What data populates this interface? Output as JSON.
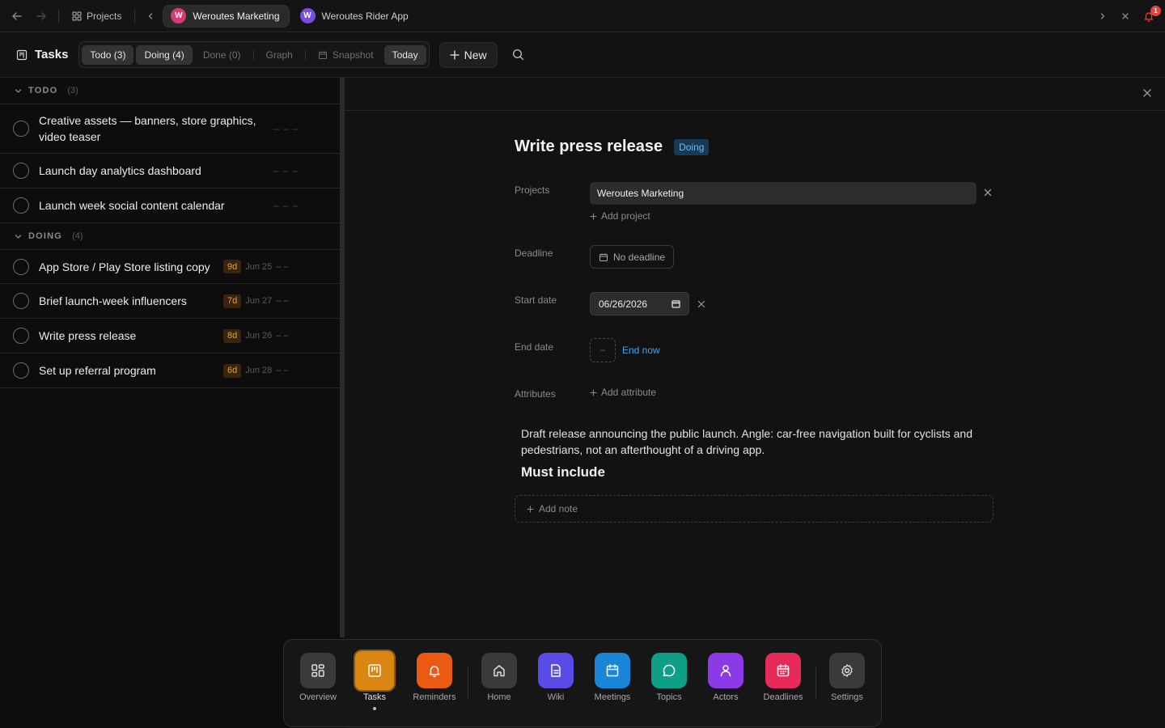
{
  "topbar": {
    "projects_label": "Projects",
    "tabs": [
      {
        "label": "Weroutes Marketing",
        "initial": "W",
        "color": "#d63a78",
        "active": true
      },
      {
        "label": "Weroutes Rider App",
        "initial": "W",
        "color": "#7a4ce0",
        "active": false
      }
    ],
    "notification_count": "1"
  },
  "toolbar": {
    "title": "Tasks",
    "filters": {
      "todo": "Todo (3)",
      "doing": "Doing (4)",
      "done": "Done (0)",
      "graph": "Graph",
      "snapshot": "Snapshot",
      "today": "Today"
    },
    "new_label": "New"
  },
  "list": {
    "todo": {
      "label": "TODO",
      "count": "(3)",
      "items": [
        {
          "title": "Creative assets — banners, store graphics, video teaser",
          "dashes": "– – –"
        },
        {
          "title": "Launch day analytics dashboard",
          "dashes": "– – –"
        },
        {
          "title": "Launch week social content calendar",
          "dashes": "– – –"
        }
      ]
    },
    "doing": {
      "label": "DOING",
      "count": "(4)",
      "items": [
        {
          "title": "App Store / Play Store listing copy",
          "days": "9d",
          "date": "Jun 25",
          "dashes": "– –"
        },
        {
          "title": "Brief launch-week influencers",
          "days": "7d",
          "date": "Jun 27",
          "dashes": "– –"
        },
        {
          "title": "Write press release",
          "days": "8d",
          "date": "Jun 26",
          "dashes": "– –"
        },
        {
          "title": "Set up referral program",
          "days": "6d",
          "date": "Jun 28",
          "dashes": "– –"
        }
      ]
    }
  },
  "detail": {
    "title": "Write press release",
    "status": "Doing",
    "labels": {
      "projects": "Projects",
      "deadline": "Deadline",
      "start_date": "Start date",
      "end_date": "End date",
      "attributes": "Attributes"
    },
    "project_chip": "Weroutes Marketing",
    "add_project": "Add project",
    "deadline_value": "No deadline",
    "start_date_value": "06/26/2026",
    "end_box": "–",
    "end_now": "End now",
    "add_attribute": "Add attribute",
    "description": "Draft release announcing the public launch. Angle: car-free navigation built for cyclists and pedestrians, not an afterthought of a driving app.",
    "heading": "Must include",
    "add_note": "Add note"
  },
  "dock": {
    "items": [
      {
        "label": "Overview",
        "icon": "grid-icon",
        "color": "#3a3a3a"
      },
      {
        "label": "Tasks",
        "icon": "kanban-icon",
        "color": "#d98612"
      },
      {
        "label": "Reminders",
        "icon": "bell-icon",
        "color": "#ea5a12"
      },
      {
        "label": "Home",
        "icon": "home-icon",
        "color": "#3a3a3a"
      },
      {
        "label": "Wiki",
        "icon": "document-icon",
        "color": "#5a4be6"
      },
      {
        "label": "Meetings",
        "icon": "calendar-icon",
        "color": "#1a86d8"
      },
      {
        "label": "Topics",
        "icon": "chat-icon",
        "color": "#0f9e88"
      },
      {
        "label": "Actors",
        "icon": "person-icon",
        "color": "#8a3ae6"
      },
      {
        "label": "Deadlines",
        "icon": "calendar-grid-icon",
        "color": "#e62a5a"
      },
      {
        "label": "Settings",
        "icon": "gear-icon",
        "color": "#3a3a3a"
      }
    ]
  }
}
